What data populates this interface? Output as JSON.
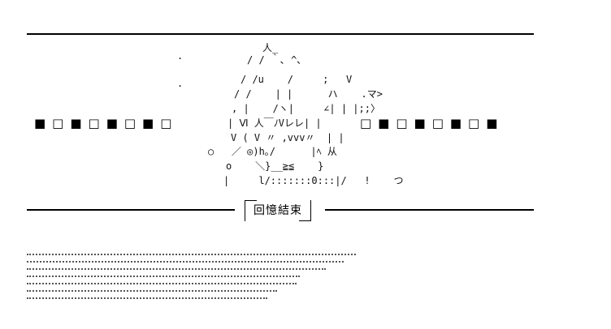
{
  "caption": "回憶結束",
  "squares_left": "■□■□■□■□",
  "squares_right": "□■□■□■□■",
  "art": [
    "人_",
    "/ / ｀､ ^､",
    "/ /u    /     ;   V",
    "/ /    | |      ハ    .マ>",
    ", |    /ヽ|     ∠| | |;;〉",
    "| Ⅵ 人￣ﾉVレレ| |",
    "V ( V 〃 ,vvv〃  | |",
    "○   ／ ◎)h｡/      |ﾍ 从",
    "o    ＼}__≧≦    }",
    "|     l/:::::::0:::|/   !    つ"
  ],
  "small_marks": [
    ".",
    "."
  ]
}
